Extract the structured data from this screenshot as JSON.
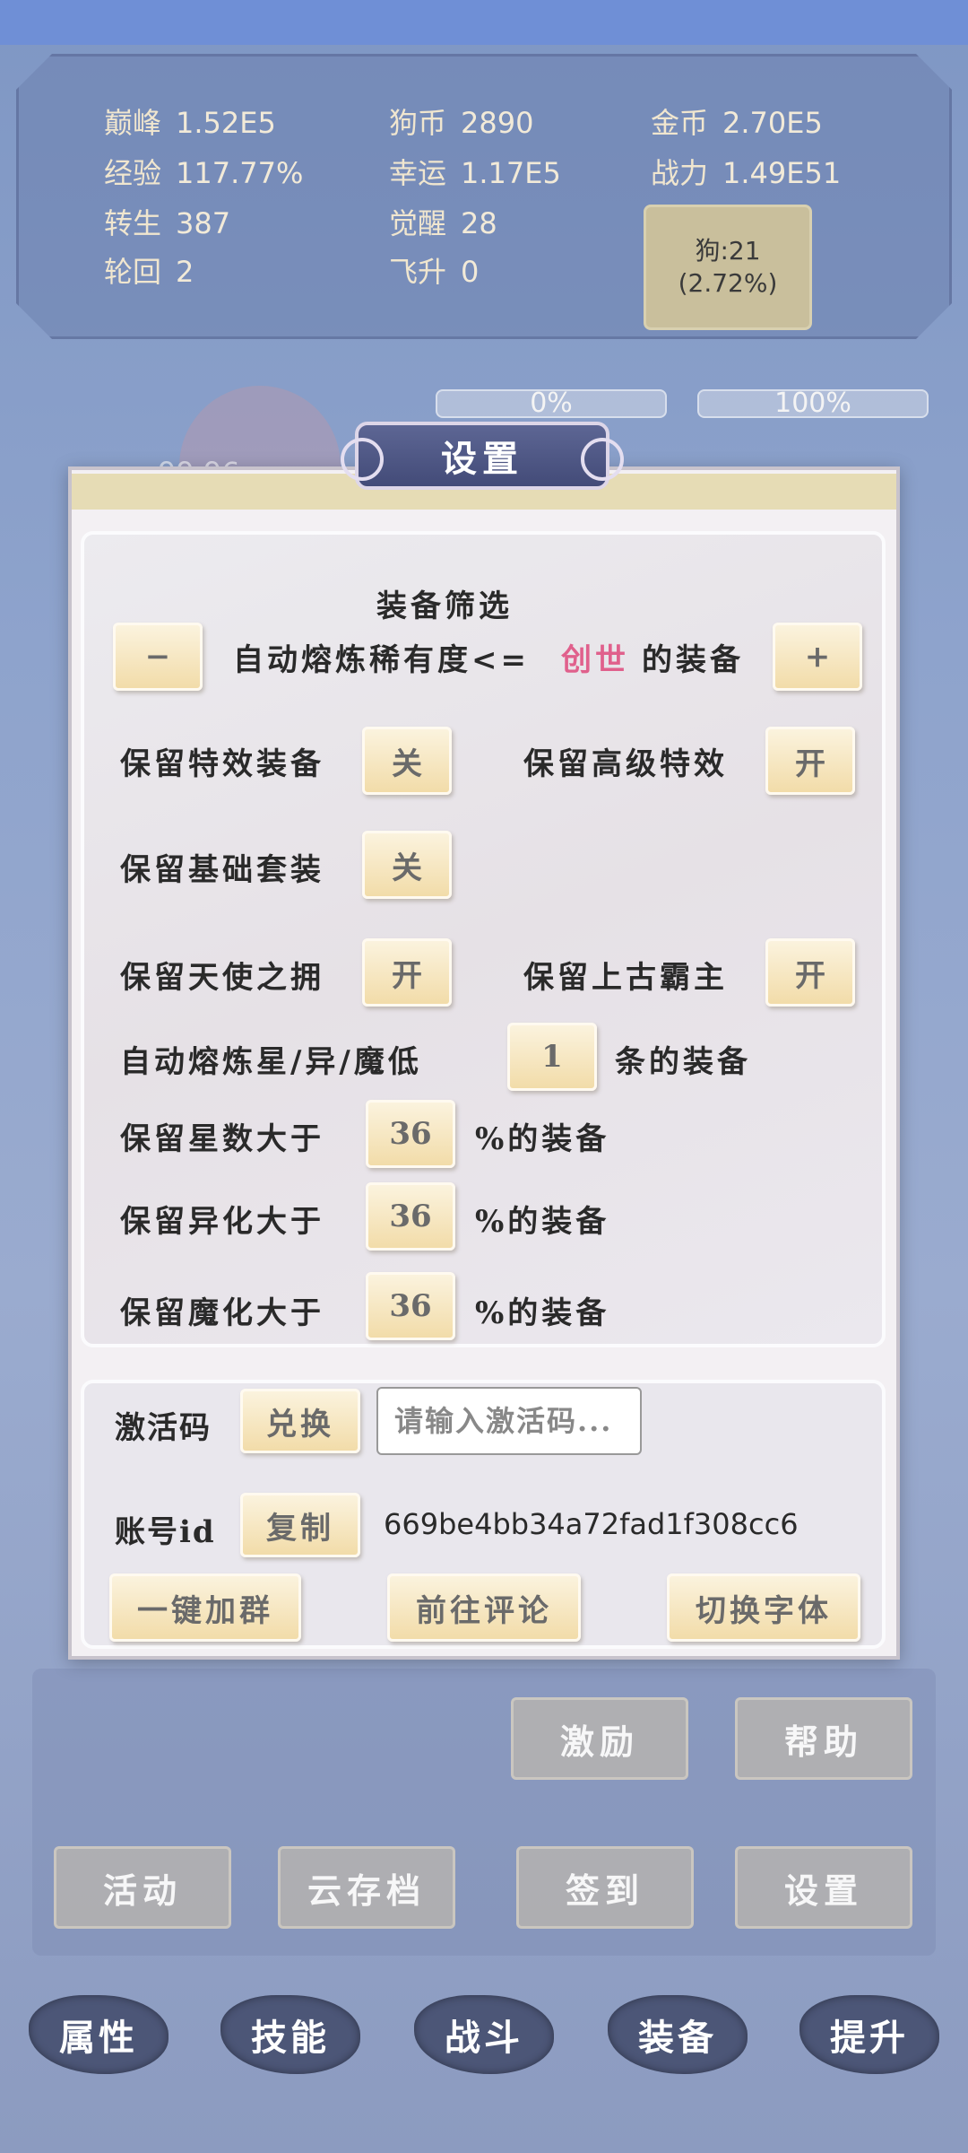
{
  "stats": {
    "peak_label": "巅峰",
    "peak_value": "1.52E5",
    "dogcoin_label": "狗币",
    "dogcoin_value": "2890",
    "gold_label": "金币",
    "gold_value": "2.70E5",
    "exp_label": "经验",
    "exp_value": "117.77%",
    "luck_label": "幸运",
    "luck_value": "1.17E5",
    "power_label": "战力",
    "power_value": "1.49E51",
    "rebirth_label": "转生",
    "rebirth_value": "387",
    "awaken_label": "觉醒",
    "awaken_value": "28",
    "cycle_label": "轮回",
    "cycle_value": "2",
    "ascend_label": "飞升",
    "ascend_value": "0",
    "dog_line1": "狗:21",
    "dog_line2": "(2.72%)"
  },
  "background": {
    "progress_left": "0%",
    "progress_right": "100%",
    "faded_value": "99.96"
  },
  "settings": {
    "title": "设置",
    "section_title": "装备筛选",
    "minus_label": "−",
    "plus_label": "+",
    "auto_smelt_prefix": "自动熔炼稀有度<=",
    "rarity_value": "创世",
    "auto_smelt_suffix": "的装备",
    "keep_effect_label": "保留特效装备",
    "keep_effect_value": "关",
    "keep_adv_effect_label": "保留高级特效",
    "keep_adv_effect_value": "开",
    "keep_basic_set_label": "保留基础套装",
    "keep_basic_set_value": "关",
    "keep_angel_label": "保留天使之拥",
    "keep_angel_value": "开",
    "keep_ancient_label": "保留上古霸主",
    "keep_ancient_value": "开",
    "auto_smelt_star_label": "自动熔炼星/异/魔低",
    "auto_smelt_star_value": "1",
    "auto_smelt_star_suffix": "条的装备",
    "keep_star_label": "保留星数大于",
    "keep_star_value": "36",
    "keep_star_suffix": "%的装备",
    "keep_mutate_label": "保留异化大于",
    "keep_mutate_value": "36",
    "keep_mutate_suffix": "%的装备",
    "keep_demon_label": "保留魔化大于",
    "keep_demon_value": "36",
    "keep_demon_suffix": "%的装备",
    "code_label": "激活码",
    "redeem_label": "兑换",
    "code_placeholder": "请输入激活码...",
    "account_label": "账号id",
    "copy_label": "复制",
    "account_id": "669be4bb34a72fad1f308cc6",
    "join_group_label": "一键加群",
    "review_label": "前往评论",
    "switch_font_label": "切换字体"
  },
  "under_buttons": {
    "incentive": "激励",
    "help": "帮助",
    "activity": "活动",
    "cloud_save": "云存档",
    "checkin": "签到",
    "settings": "设置"
  },
  "nav": {
    "attributes": "属性",
    "skills": "技能",
    "battle": "战斗",
    "equipment": "装备",
    "upgrade": "提升"
  }
}
